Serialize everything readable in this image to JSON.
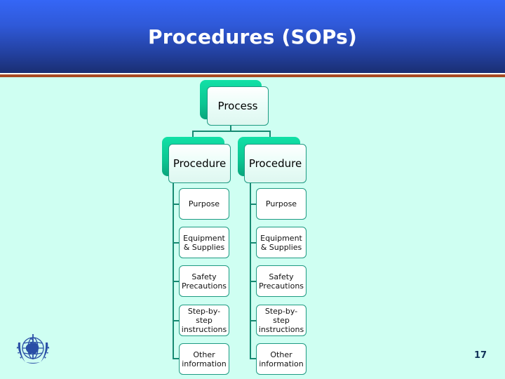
{
  "slide": {
    "title": "Procedures (SOPs)",
    "page_number": "17",
    "logo": "who-emblem-icon"
  },
  "colors": {
    "header_top": "#3566f6",
    "header_bottom": "#1a2e72",
    "accent_rule": "#a84a22",
    "background": "#cffff2",
    "node_tab": "#12e0a6",
    "connector": "#178a72",
    "page_number": "#13345a"
  },
  "diagram": {
    "root": {
      "label": "Process"
    },
    "procedures": [
      {
        "label": "Procedure",
        "items": [
          "Purpose",
          "Equipment\n& Supplies",
          "Safety\nPrecautions",
          "Step-by-\nstep\ninstructions",
          "Other\ninformation"
        ]
      },
      {
        "label": "Procedure",
        "items": [
          "Purpose",
          "Equipment\n& Supplies",
          "Safety\nPrecautions",
          "Step-by-\nstep\ninstructions",
          "Other\ninformation"
        ]
      }
    ]
  }
}
